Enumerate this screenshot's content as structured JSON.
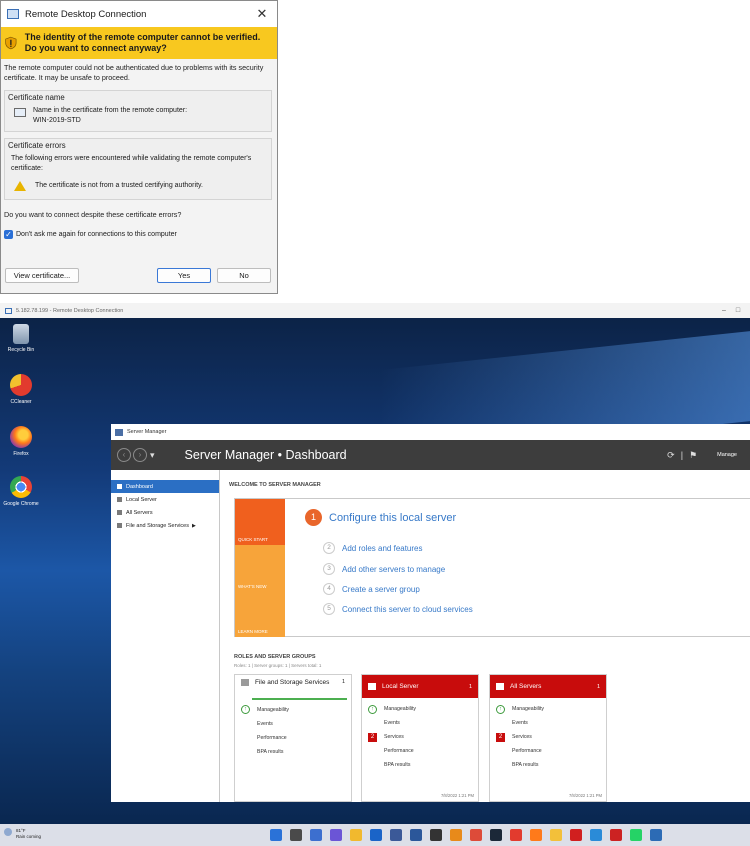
{
  "dialog": {
    "title": "Remote Desktop Connection",
    "close_glyph": "✕",
    "warning_text": "The identity of the remote computer cannot be verified. Do you want to connect anyway?",
    "explanation": "The remote computer could not be authenticated due to problems with its security certificate. It may be unsafe to proceed.",
    "cert_name_group": "Certificate name",
    "cert_name_label": "Name in the certificate from the remote computer:",
    "cert_name_value": "WIN-2019-STD",
    "cert_errors_group": "Certificate errors",
    "cert_errors_intro": "The following errors were encountered while validating the remote computer's certificate:",
    "cert_error_item": "The certificate is not from a trusted certifying authority.",
    "question": "Do you want to connect despite these certificate errors?",
    "dont_ask_label": "Don't ask me again for connections to this computer",
    "dont_ask_checked": true,
    "view_cert_button": "View certificate...",
    "yes_button": "Yes",
    "no_button": "No",
    "warning_color": "#f8c81f"
  },
  "remote_window": {
    "title": "5.182.78.199 - Remote Desktop Connection"
  },
  "desktop_icons": [
    {
      "label": "Recycle Bin",
      "icon": "recycle-bin-icon"
    },
    {
      "label": "CCleaner",
      "icon": "ccleaner-icon"
    },
    {
      "label": "Firefox",
      "icon": "firefox-icon"
    },
    {
      "label": "Google Chrome",
      "icon": "chrome-icon"
    }
  ],
  "server_manager": {
    "window_title": "Server Manager",
    "header_title": "Server Manager • Dashboard",
    "manage_label": "Manage",
    "sidebar": [
      {
        "label": "Dashboard",
        "selected": true
      },
      {
        "label": "Local Server"
      },
      {
        "label": "All Servers"
      },
      {
        "label": "File and Storage Services",
        "arrow": "▶"
      }
    ],
    "welcome_heading": "WELCOME TO SERVER MANAGER",
    "tiles": [
      {
        "label": "QUICK START",
        "color": "#f0601e"
      },
      {
        "label": "WHAT'S NEW",
        "color": "#f7a43a"
      },
      {
        "label": "LEARN MORE",
        "color": "#f7a43a"
      }
    ],
    "steps": [
      {
        "num": "1",
        "label": "Configure this local server"
      },
      {
        "num": "2",
        "label": "Add roles and features"
      },
      {
        "num": "3",
        "label": "Add other servers to manage"
      },
      {
        "num": "4",
        "label": "Create a server group"
      },
      {
        "num": "5",
        "label": "Connect this server to cloud services"
      }
    ],
    "roles_heading": "ROLES AND SERVER GROUPS",
    "roles_summary": "Roles: 1 | Server groups: 1 | Servers total: 1",
    "cards": [
      {
        "title": "File and Storage Services",
        "count": "1",
        "alert": false,
        "rows": [
          {
            "label": "Manageability",
            "badge": "ok"
          },
          {
            "label": "Events",
            "badge": ""
          },
          {
            "label": "Performance",
            "badge": ""
          },
          {
            "label": "BPA results",
            "badge": ""
          }
        ],
        "timestamp": ""
      },
      {
        "title": "Local Server",
        "count": "1",
        "alert": true,
        "rows": [
          {
            "label": "Manageability",
            "badge": "ok"
          },
          {
            "label": "Events",
            "badge": ""
          },
          {
            "label": "Services",
            "badge": "2"
          },
          {
            "label": "Performance",
            "badge": ""
          },
          {
            "label": "BPA results",
            "badge": ""
          }
        ],
        "timestamp": "7/8/2022 1:21 PM"
      },
      {
        "title": "All Servers",
        "count": "1",
        "alert": true,
        "rows": [
          {
            "label": "Manageability",
            "badge": "ok"
          },
          {
            "label": "Events",
            "badge": ""
          },
          {
            "label": "Services",
            "badge": "2"
          },
          {
            "label": "Performance",
            "badge": ""
          },
          {
            "label": "BPA results",
            "badge": ""
          }
        ],
        "timestamp": "7/8/2022 1:21 PM"
      }
    ],
    "alert_color": "#c80c0c"
  },
  "taskbar": {
    "weather_temp": "81°F",
    "weather_desc": "Rain coming",
    "icons": [
      "start-icon",
      "search-icon",
      "widgets-icon",
      "chat-icon",
      "file-explorer-icon",
      "outlook-icon",
      "store-icon",
      "word-icon",
      "terminal-icon",
      "paint-icon",
      "chrome-icon",
      "steam-icon",
      "ccleaner-icon",
      "firefox-icon",
      "folder-icon",
      "acrobat-icon",
      "mail-icon",
      "notification-icon",
      "whatsapp-icon",
      "device-icon"
    ]
  }
}
